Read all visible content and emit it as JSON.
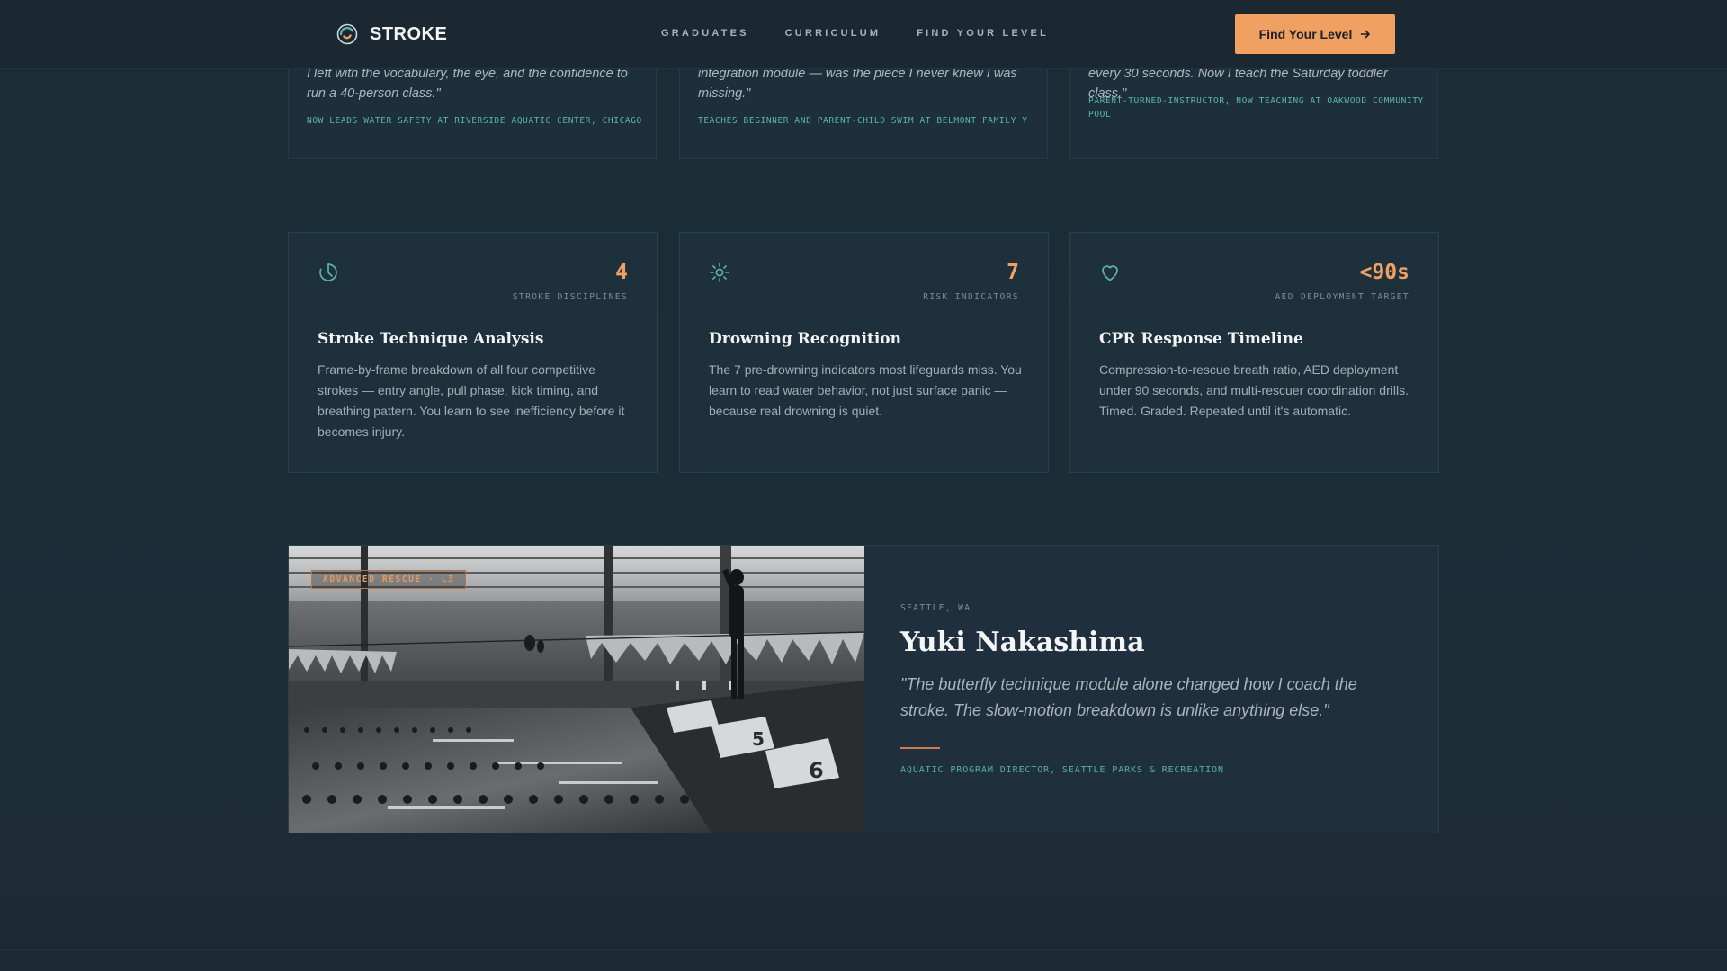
{
  "header": {
    "brand": "STROKE",
    "nav": [
      "GRADUATES",
      "CURRICULUM",
      "FIND YOUR LEVEL"
    ],
    "cta_label": "Find Your Level",
    "cta_icon": "arrow-right-icon"
  },
  "testimonials": [
    {
      "quote": "I left with the vocabulary, the eye, and the confidence to run a 40-person class.\"",
      "role": "NOW LEADS WATER SAFETY AT RIVERSIDE AQUATIC CENTER, CHICAGO"
    },
    {
      "quote": "integration module — was the piece I never knew I was missing.\"",
      "role": "TEACHES BEGINNER AND PARENT-CHILD SWIM AT BELMONT FAMILY Y"
    },
    {
      "quote": "every 30 seconds. Now I teach the Saturday toddler class.\"",
      "role": "PARENT-TURNED-INSTRUCTOR, NOW TEACHING AT OAKWOOD COMMUNITY POOL"
    }
  ],
  "features": [
    {
      "icon": "timer-icon",
      "stat": "4",
      "stat_label": "STROKE DISCIPLINES",
      "title": "Stroke Technique Analysis",
      "desc": "Frame-by-frame breakdown of all four competitive strokes — entry angle, pull phase, kick timing, and breathing pattern. You learn to see inefficiency before it becomes injury."
    },
    {
      "icon": "sun-icon",
      "stat": "7",
      "stat_label": "RISK INDICATORS",
      "title": "Drowning Recognition",
      "desc": "The 7 pre-drowning indicators most lifeguards miss. You learn to read water behavior, not just surface panic — because real drowning is quiet."
    },
    {
      "icon": "heart-icon",
      "stat": "<90s",
      "stat_label": "AED DEPLOYMENT TARGET",
      "title": "CPR Response Timeline",
      "desc": "Compression-to-rescue breath ratio, AED deployment under 90 seconds, and multi-rescuer coordination drills. Timed. Graded. Repeated until it's automatic."
    }
  ],
  "profile": {
    "badge": "ADVANCED RESCUE · L3",
    "location": "SEATTLE, WA",
    "name": "Yuki Nakashima",
    "quote": "\"The butterfly technique module alone changed how I coach the stroke. The slow-motion breakdown is unlike anything else.\"",
    "role": "AQUATIC PROGRAM DIRECTOR, SEATTLE PARKS & RECREATION"
  },
  "colors": {
    "accent": "#f0a060",
    "teal": "#56b0a7",
    "background": "#1b2e38"
  }
}
